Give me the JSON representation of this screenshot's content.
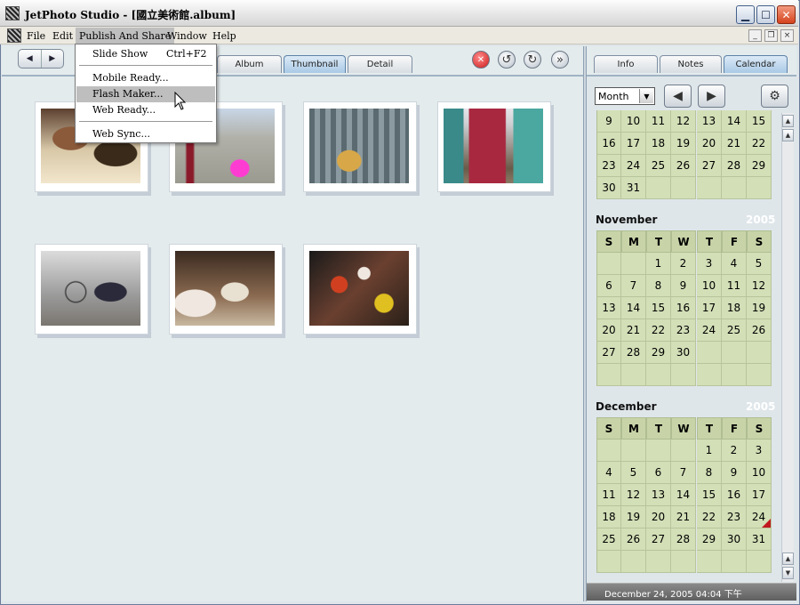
{
  "window": {
    "title": "JetPhoto Studio - [國立美術館.album]"
  },
  "menubar": {
    "items": [
      "File",
      "Edit",
      "Publish And Share",
      "Window",
      "Help"
    ]
  },
  "menu_publish": {
    "items": [
      {
        "label": "Slide Show",
        "shortcut": "Ctrl+F2"
      },
      {
        "label": "Mobile Ready...",
        "shortcut": ""
      },
      {
        "label": "Flash Maker...",
        "shortcut": ""
      },
      {
        "label": "Web Ready...",
        "shortcut": ""
      },
      {
        "label": "Web Sync...",
        "shortcut": ""
      }
    ]
  },
  "view_tabs": [
    "Album",
    "Thumbnail",
    "Detail"
  ],
  "view_tabs_selected": "Thumbnail",
  "right_tabs": [
    "Info",
    "Notes",
    "Calendar"
  ],
  "right_tabs_selected": "Calendar",
  "calendar_controls": {
    "mode": "Month"
  },
  "dow": [
    "S",
    "M",
    "T",
    "W",
    "T",
    "F",
    "S"
  ],
  "months": [
    {
      "name": "",
      "year": "",
      "weeks": [
        [
          "9",
          "10",
          "11",
          "12",
          "13",
          "14",
          "15"
        ],
        [
          "16",
          "17",
          "18",
          "19",
          "20",
          "21",
          "22"
        ],
        [
          "23",
          "24",
          "25",
          "26",
          "27",
          "28",
          "29"
        ],
        [
          "30",
          "31",
          "",
          "",
          "",
          "",
          ""
        ]
      ]
    },
    {
      "name": "November",
      "year": "2005",
      "weeks": [
        [
          "",
          "",
          "1",
          "2",
          "3",
          "4",
          "5"
        ],
        [
          "6",
          "7",
          "8",
          "9",
          "10",
          "11",
          "12"
        ],
        [
          "13",
          "14",
          "15",
          "16",
          "17",
          "18",
          "19"
        ],
        [
          "20",
          "21",
          "22",
          "23",
          "24",
          "25",
          "26"
        ],
        [
          "27",
          "28",
          "29",
          "30",
          "",
          "",
          ""
        ],
        [
          "",
          "",
          "",
          "",
          "",
          "",
          ""
        ]
      ]
    },
    {
      "name": "December",
      "year": "2005",
      "weeks": [
        [
          "",
          "",
          "",
          "",
          "1",
          "2",
          "3"
        ],
        [
          "4",
          "5",
          "6",
          "7",
          "8",
          "9",
          "10"
        ],
        [
          "11",
          "12",
          "13",
          "14",
          "15",
          "16",
          "17"
        ],
        [
          "18",
          "19",
          "20",
          "21",
          "22",
          "23",
          "24"
        ],
        [
          "25",
          "26",
          "27",
          "28",
          "29",
          "30",
          "31"
        ],
        [
          "",
          "",
          "",
          "",
          "",
          "",
          ""
        ]
      ]
    }
  ],
  "status": {
    "text": "December 24, 2005 04:04 下午"
  },
  "photos": [
    {
      "name": "photo-1"
    },
    {
      "name": "photo-2"
    },
    {
      "name": "photo-3"
    },
    {
      "name": "photo-4"
    },
    {
      "name": "photo-5"
    },
    {
      "name": "photo-6"
    },
    {
      "name": "photo-7"
    }
  ],
  "colors": {
    "selected_tab": "#a9c9e6",
    "calendar_bg": "#d3dfb7",
    "marked_day": "#c0181e"
  }
}
